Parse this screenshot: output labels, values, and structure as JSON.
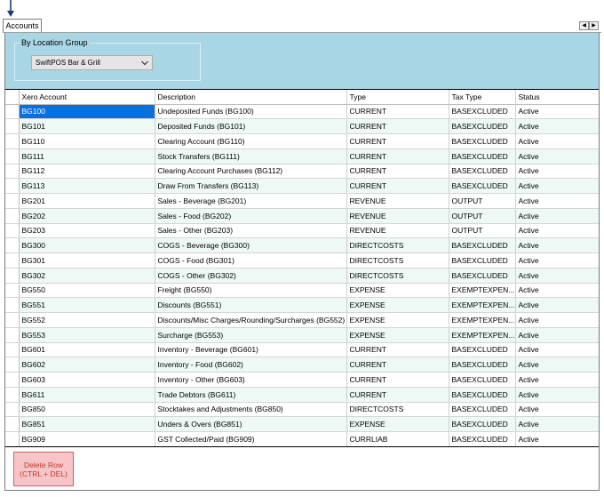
{
  "tab": {
    "label": "Accounts"
  },
  "filter": {
    "group_label": "By Location Group",
    "location_value": "SwiftPOS Bar & Grill"
  },
  "grid": {
    "columns": [
      "Xero Account",
      "Description",
      "Type",
      "Tax Type",
      "Status"
    ],
    "rows": [
      [
        "BG100",
        "Undeposited Funds (BG100)",
        "CURRENT",
        "BASEXCLUDED",
        "Active"
      ],
      [
        "BG101",
        "Deposited Funds (BG101)",
        "CURRENT",
        "BASEXCLUDED",
        "Active"
      ],
      [
        "BG110",
        "Clearing Account (BG110)",
        "CURRENT",
        "BASEXCLUDED",
        "Active"
      ],
      [
        "BG111",
        "Stock Transfers (BG111)",
        "CURRENT",
        "BASEXCLUDED",
        "Active"
      ],
      [
        "BG112",
        "Clearing Account Purchases (BG112)",
        "CURRENT",
        "BASEXCLUDED",
        "Active"
      ],
      [
        "BG113",
        "Draw From Transfers (BG113)",
        "CURRENT",
        "BASEXCLUDED",
        "Active"
      ],
      [
        "BG201",
        "Sales - Beverage (BG201)",
        "REVENUE",
        "OUTPUT",
        "Active"
      ],
      [
        "BG202",
        "Sales - Food (BG202)",
        "REVENUE",
        "OUTPUT",
        "Active"
      ],
      [
        "BG203",
        "Sales - Other (BG203)",
        "REVENUE",
        "OUTPUT",
        "Active"
      ],
      [
        "BG300",
        "COGS - Beverage (BG300)",
        "DIRECTCOSTS",
        "BASEXCLUDED",
        "Active"
      ],
      [
        "BG301",
        "COGS - Food (BG301)",
        "DIRECTCOSTS",
        "BASEXCLUDED",
        "Active"
      ],
      [
        "BG302",
        "COGS - Other (BG302)",
        "DIRECTCOSTS",
        "BASEXCLUDED",
        "Active"
      ],
      [
        "BG550",
        "Freight (BG550)",
        "EXPENSE",
        "EXEMPTEXPEN...",
        "Active"
      ],
      [
        "BG551",
        "Discounts (BG551)",
        "EXPENSE",
        "EXEMPTEXPEN...",
        "Active"
      ],
      [
        "BG552",
        "Discounts/Misc Charges/Rounding/Surcharges (BG552)",
        "EXPENSE",
        "EXEMPTEXPEN...",
        "Active"
      ],
      [
        "BG553",
        "Surcharge (BG553)",
        "EXPENSE",
        "EXEMPTEXPEN...",
        "Active"
      ],
      [
        "BG601",
        "Inventory - Beverage (BG601)",
        "CURRENT",
        "BASEXCLUDED",
        "Active"
      ],
      [
        "BG602",
        "Inventory - Food (BG602)",
        "CURRENT",
        "BASEXCLUDED",
        "Active"
      ],
      [
        "BG603",
        "Inventory - Other (BG603)",
        "CURRENT",
        "BASEXCLUDED",
        "Active"
      ],
      [
        "BG611",
        "Trade Debtors (BG611)",
        "CURRENT",
        "BASEXCLUDED",
        "Active"
      ],
      [
        "BG850",
        "Stocktakes and Adjustments (BG850)",
        "DIRECTCOSTS",
        "BASEXCLUDED",
        "Active"
      ],
      [
        "BG851",
        "Unders & Overs (BG851)",
        "EXPENSE",
        "BASEXCLUDED",
        "Active"
      ],
      [
        "BG909",
        "GST Collected/Paid (BG909)",
        "CURRLIAB",
        "BASEXCLUDED",
        "Active"
      ]
    ]
  },
  "actions": {
    "delete_row_label": "Delete Row\n(CTRL + DEL)"
  },
  "colors": {
    "panel": "#a9d6e5",
    "selection": "#0d6fd9",
    "alt_row": "#eef9f5",
    "delete_bg": "#f7c5c8"
  },
  "icons": {
    "pointer": "down-arrow-icon",
    "prev": "chevron-left-icon",
    "next": "chevron-right-icon",
    "dropdown": "chevron-down-icon"
  }
}
